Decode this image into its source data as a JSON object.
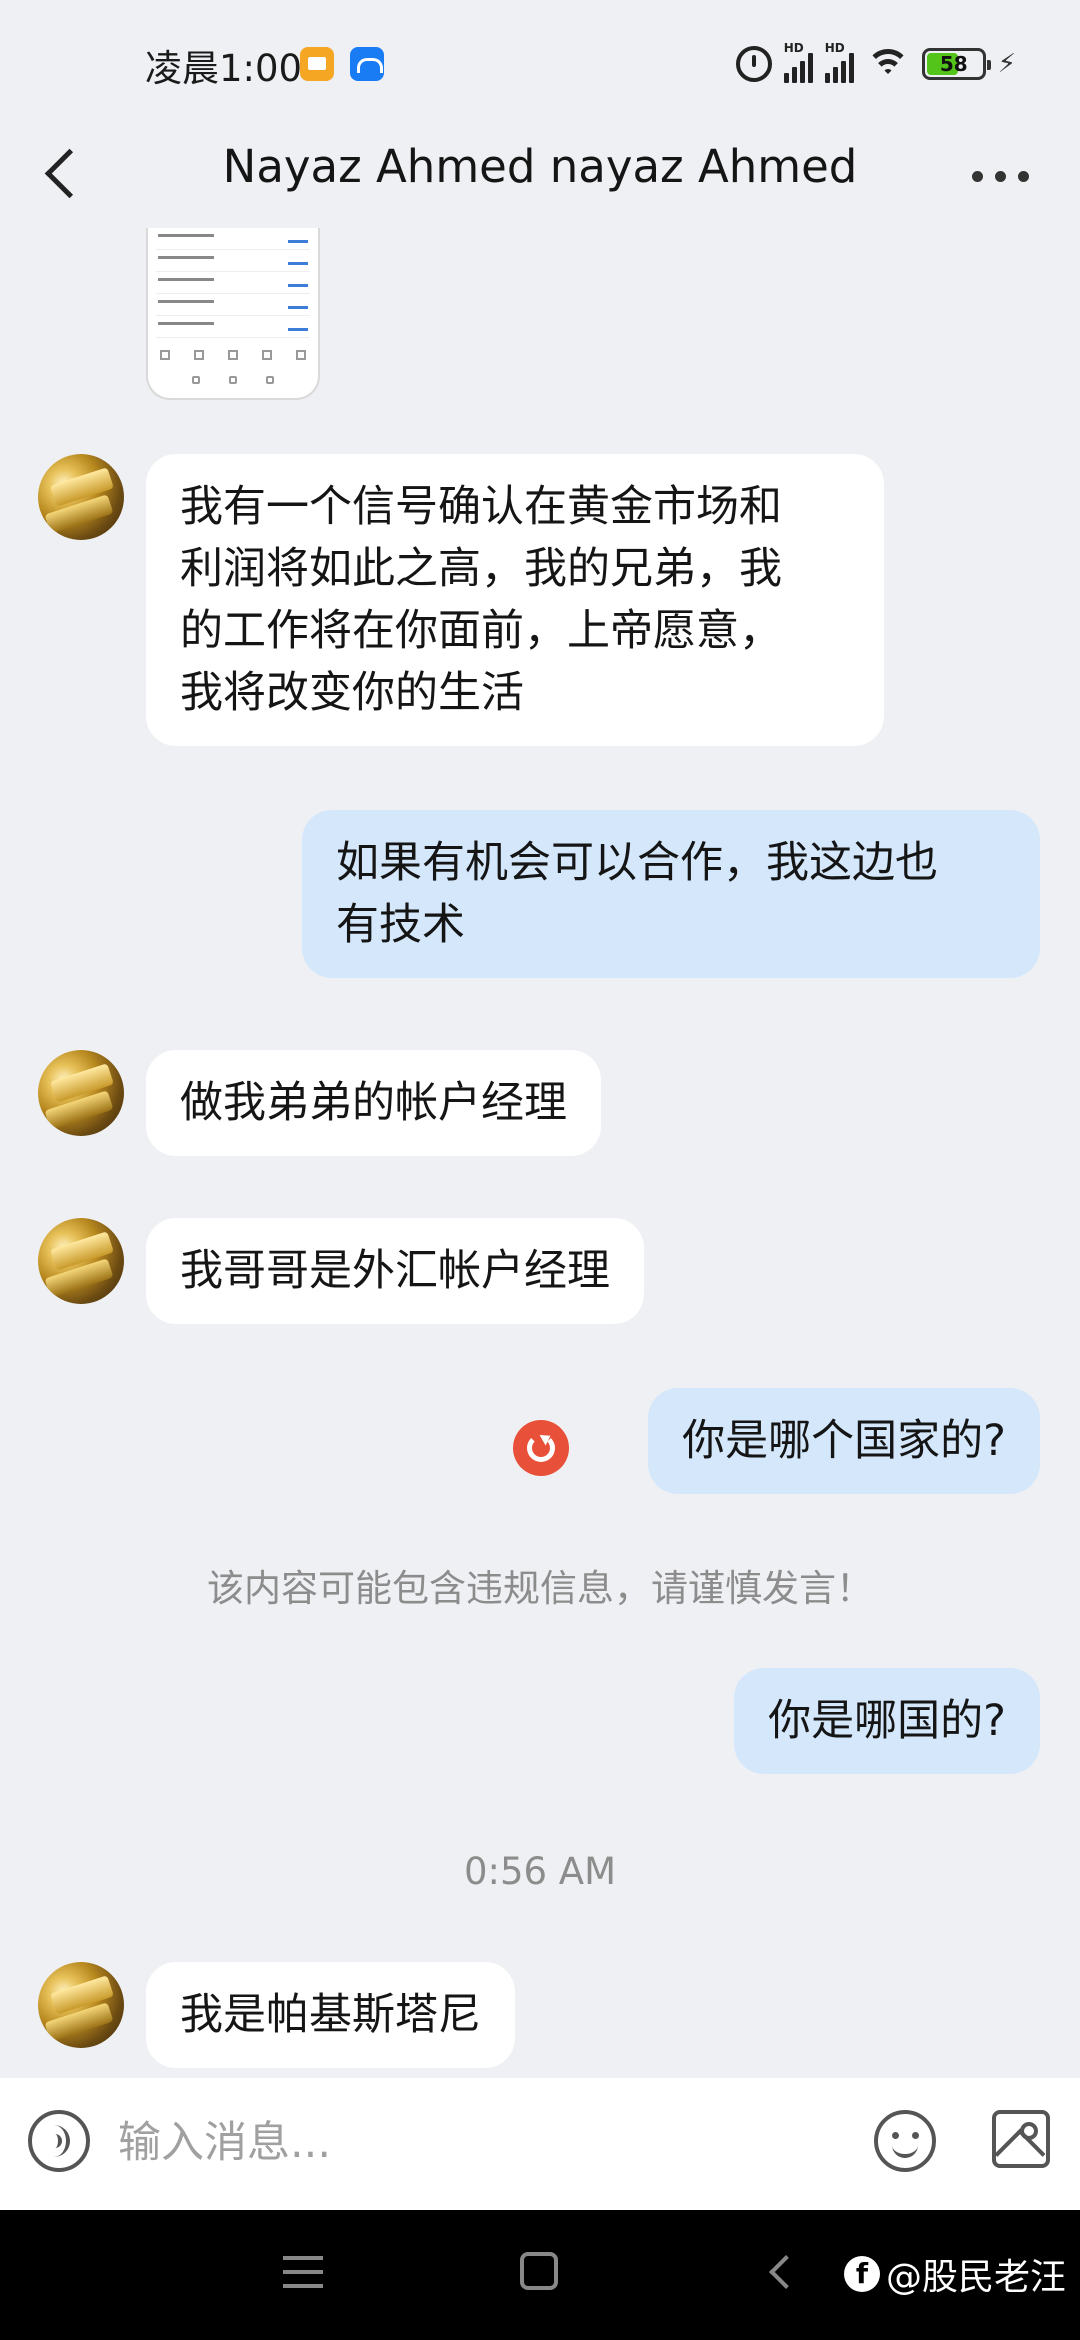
{
  "status_bar": {
    "time": "凌晨1:00",
    "signal_1_label": "HD",
    "signal_2_label": "HD",
    "battery": "58"
  },
  "header": {
    "title": "Nayaz Ahmed nayaz Ahmed"
  },
  "messages": [
    {
      "side": "in",
      "text": "我有一个信号确认在黄金市场和\n利润将如此之高，我的兄弟，我\n的工作将在你面前，上帝愿意，\n我将改变你的生活"
    },
    {
      "side": "out",
      "text": "如果有机会可以合作，我这边也\n有技术"
    },
    {
      "side": "in",
      "text": "做我弟弟的帐户经理"
    },
    {
      "side": "in",
      "text": "我哥哥是外汇帐户经理"
    },
    {
      "side": "out",
      "text": "你是哪个国家的?"
    },
    {
      "side": "out",
      "text": "你是哪国的?"
    },
    {
      "side": "in",
      "text": "我是帕基斯塔尼"
    }
  ],
  "notice": "该内容可能包含违规信息，请谨慎发言！",
  "timestamp": "0:56 AM",
  "input": {
    "placeholder": "输入消息..."
  },
  "watermark": "@股民老汪",
  "icons": {
    "back": "chevron-left-icon",
    "more": "more-dots-icon",
    "voice": "voice-icon",
    "emoji": "emoji-icon",
    "image": "image-icon",
    "resend": "resend-icon"
  },
  "colors": {
    "background": "#eff0f3",
    "incoming_bubble": "#ffffff",
    "outgoing_bubble": "#d4e7fb",
    "resend": "#e8503a"
  }
}
